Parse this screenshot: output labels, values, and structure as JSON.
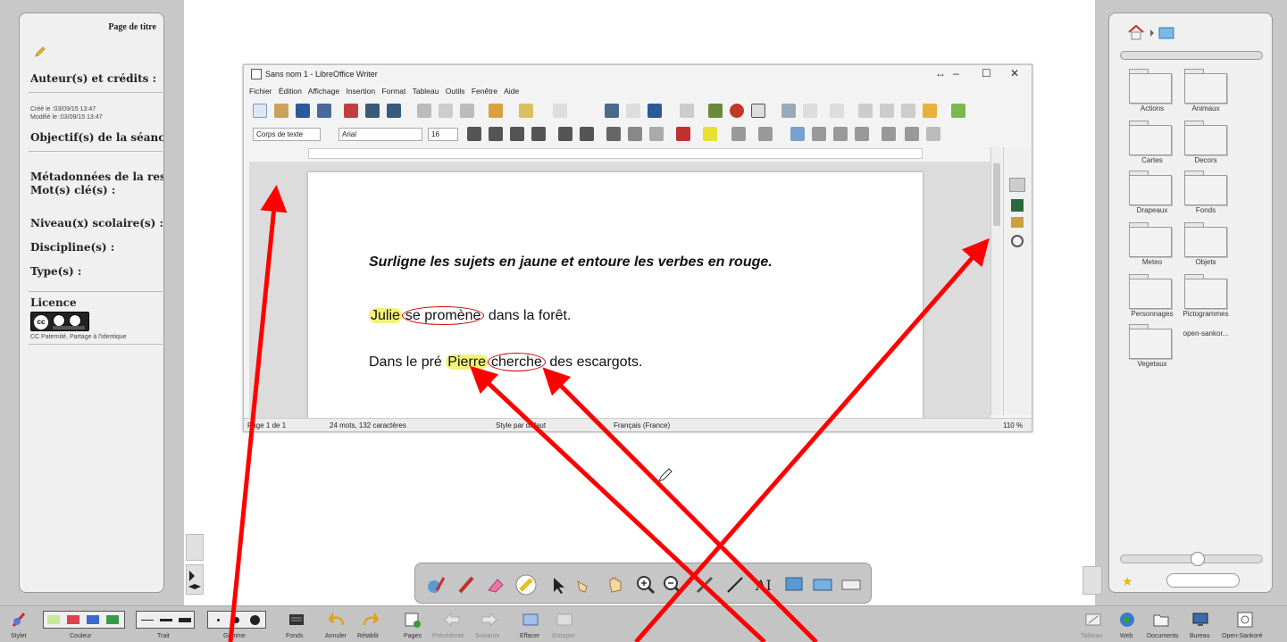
{
  "left_panel": {
    "title": "Page de titre",
    "author_heading": "Auteur(s) et crédits :",
    "created": "Créé le :03/09/15 13:47",
    "modified": "Modifié le :03/09/15 13:47",
    "objective_heading": "Objectif(s) de la séance",
    "metadata_heading": "Métadonnées de la ressc",
    "keywords_heading": "Mot(s) clé(s) :",
    "level_heading": "Niveau(x) scolaire(s) :",
    "discipline_heading": "Discipline(s) :",
    "type_heading": "Type(s) :",
    "licence_heading": "Licence",
    "licence_name": "CC Paternité, Partage à l'identique"
  },
  "lo_window": {
    "title": "Sans nom 1 - LibreOffice Writer",
    "menu": [
      "Fichier",
      "Édition",
      "Affichage",
      "Insertion",
      "Format",
      "Tableau",
      "Outils",
      "Fenêtre",
      "Aide"
    ],
    "para_style": "Corps de texte",
    "font_name": "Arial",
    "font_size": "16",
    "document": {
      "instruction": "Surligne les sujets en jaune et entoure les verbes en rouge.",
      "s1_subject": "Julie",
      "s1_verb": "se promène",
      "s1_rest": "dans la forêt.",
      "s2_start": "Dans le pré",
      "s2_subject": "Pierre",
      "s2_verb": "cherche",
      "s2_rest": "des escargots."
    },
    "status": {
      "page": "Page 1 de 1",
      "words": "24 mots, 132 caractères",
      "style": "Style par défaut",
      "language": "Français (France)",
      "zoom": "110 %"
    }
  },
  "right_panel": {
    "folders": [
      "Actions",
      "Animaux",
      "Cartes",
      "Decors",
      "Drapeaux",
      "Fonds",
      "Meteo",
      "Objets",
      "Personnages",
      "Pictogrammes",
      "Vegetaux"
    ],
    "pictogram_extra": "open-sankor..."
  },
  "bottom_bar": {
    "stylet": "Stylet",
    "couleur": "Couleur",
    "trait": "Trait",
    "gomme": "Gomme",
    "fonds": "Fonds",
    "annuler": "Annuler",
    "retablir": "Rétablir",
    "pages": "Pages",
    "precedente": "Précédente",
    "suivante": "Suivante",
    "effacer": "Effacer",
    "grouper": "Grouper",
    "tableau": "Tableau",
    "web": "Web",
    "documents": "Documents",
    "bureau": "Bureau",
    "open_sankore": "Open-Sankoré"
  },
  "colors": {
    "annotation_arrow": "#ff0000",
    "highlight_yellow": "#f2f27a",
    "circle_red": "#d00000"
  }
}
